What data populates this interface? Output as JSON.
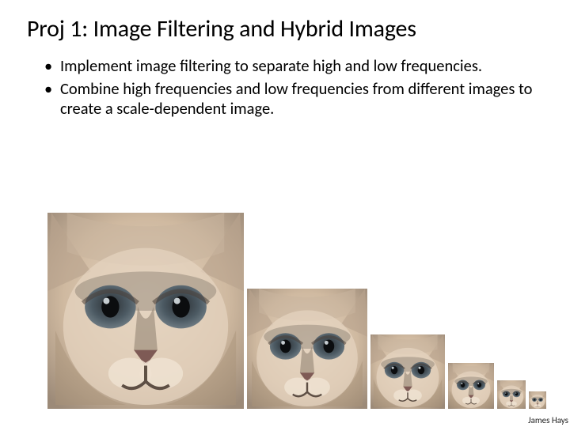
{
  "title": "Proj 1: Image Filtering and Hybrid Images",
  "bullets": [
    "Implement image filtering to separate high and low frequencies.",
    "Combine high frequencies and low frequencies from different images to create a scale-dependent image."
  ],
  "images": {
    "description": "hybrid-image-scale-pyramid",
    "sizes": [
      248,
      152,
      94,
      58,
      36,
      22
    ]
  },
  "credit": "James Hays"
}
